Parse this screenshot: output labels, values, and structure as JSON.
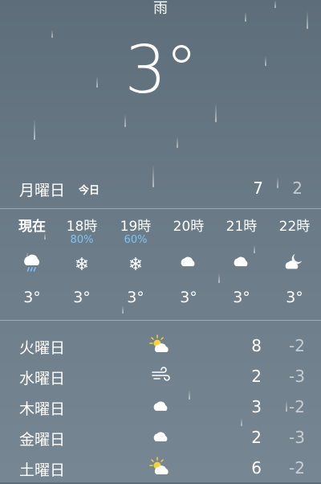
{
  "current": {
    "condition": "雨",
    "temperature": "3°"
  },
  "today": {
    "day": "月曜日",
    "label": "今日",
    "high": "7",
    "low": "2"
  },
  "hourly": [
    {
      "time": "現在",
      "pop": "",
      "icon": "rain-cloud-icon",
      "temp": "3°"
    },
    {
      "time": "18時",
      "pop": "80%",
      "icon": "snowflake-icon",
      "temp": "3°"
    },
    {
      "time": "19時",
      "pop": "60%",
      "icon": "snowflake-icon",
      "temp": "3°"
    },
    {
      "time": "20時",
      "pop": "",
      "icon": "cloud-icon",
      "temp": "3°"
    },
    {
      "time": "21時",
      "pop": "",
      "icon": "cloud-icon",
      "temp": "3°"
    },
    {
      "time": "22時",
      "pop": "",
      "icon": "partly-cloudy-night-icon",
      "temp": "3°"
    }
  ],
  "daily": [
    {
      "day": "火曜日",
      "icon": "partly-sunny-icon",
      "high": "8",
      "low": "-2"
    },
    {
      "day": "水曜日",
      "icon": "wind-icon",
      "high": "2",
      "low": "-3"
    },
    {
      "day": "木曜日",
      "icon": "cloud-icon",
      "high": "3",
      "low": "-2"
    },
    {
      "day": "金曜日",
      "icon": "cloud-icon",
      "high": "2",
      "low": "-3"
    },
    {
      "day": "土曜日",
      "icon": "partly-sunny-icon",
      "high": "6",
      "low": "-2"
    }
  ],
  "colors": {
    "background": "#6a7b87",
    "precipitation": "#7fc4f2",
    "sun": "#f6d23c"
  }
}
